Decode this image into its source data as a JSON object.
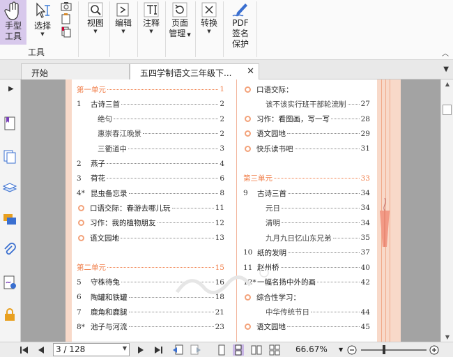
{
  "ribbon": {
    "hand_tool_line1": "手型",
    "hand_tool_line2": "工具",
    "select": "选择",
    "view": "视图",
    "edit": "编辑",
    "annotate": "注释",
    "page_manage_line1": "页面",
    "page_manage_line2": "管理",
    "convert": "转换",
    "pdf_protect_line1": "PDF",
    "pdf_protect_line2": "签名",
    "pdf_protect_line3": "保护",
    "tools_group": "工具"
  },
  "tabs": [
    {
      "label": "开始"
    },
    {
      "label": "五四学制语文三年级下..."
    }
  ],
  "toc_left": [
    {
      "num": "",
      "title": "第一单元",
      "page": "1",
      "kind": "unit"
    },
    {
      "num": "1",
      "title": "古诗三首",
      "page": "2",
      "kind": "item"
    },
    {
      "num": "",
      "title": "绝句",
      "page": "2",
      "kind": "sub"
    },
    {
      "num": "",
      "title": "惠崇春江晚景",
      "page": "2",
      "kind": "sub"
    },
    {
      "num": "",
      "title": "三衢道中",
      "page": "3",
      "kind": "sub"
    },
    {
      "num": "2",
      "title": "燕子",
      "page": "4",
      "kind": "item"
    },
    {
      "num": "3",
      "title": "荷花",
      "page": "6",
      "kind": "item"
    },
    {
      "num": "4*",
      "title": "昆虫备忘录",
      "page": "8",
      "kind": "item"
    },
    {
      "num": "",
      "title": "口语交际：春游去哪儿玩",
      "page": "11",
      "kind": "bullet"
    },
    {
      "num": "",
      "title": "习作：我的植物朋友",
      "page": "12",
      "kind": "bullet"
    },
    {
      "num": "",
      "title": "语文园地",
      "page": "13",
      "kind": "bullet"
    },
    {
      "num": "",
      "title": "",
      "page": "",
      "kind": "blank"
    },
    {
      "num": "",
      "title": "第二单元",
      "page": "15",
      "kind": "unit"
    },
    {
      "num": "5",
      "title": "守株待兔",
      "page": "16",
      "kind": "item"
    },
    {
      "num": "6",
      "title": "陶罐和铁罐",
      "page": "18",
      "kind": "item"
    },
    {
      "num": "7",
      "title": "鹿角和鹿腿",
      "page": "21",
      "kind": "item"
    },
    {
      "num": "8*",
      "title": "池子与河流",
      "page": "23",
      "kind": "item"
    }
  ],
  "toc_right": [
    {
      "num": "",
      "title": "口语交际：",
      "page": "",
      "kind": "bullet"
    },
    {
      "num": "",
      "title": "该不该实行班干部轮流制",
      "page": "27",
      "kind": "sub"
    },
    {
      "num": "",
      "title": "习作：看图画，写一写",
      "page": "28",
      "kind": "bullet"
    },
    {
      "num": "",
      "title": "语文园地",
      "page": "29",
      "kind": "bullet"
    },
    {
      "num": "",
      "title": "快乐读书吧",
      "page": "31",
      "kind": "bullet"
    },
    {
      "num": "",
      "title": "",
      "page": "",
      "kind": "blank"
    },
    {
      "num": "",
      "title": "第三单元",
      "page": "33",
      "kind": "unit"
    },
    {
      "num": "9",
      "title": "古诗三首",
      "page": "34",
      "kind": "item"
    },
    {
      "num": "",
      "title": "元日",
      "page": "34",
      "kind": "sub"
    },
    {
      "num": "",
      "title": "清明",
      "page": "34",
      "kind": "sub"
    },
    {
      "num": "",
      "title": "九月九日忆山东兄弟",
      "page": "35",
      "kind": "sub"
    },
    {
      "num": "10",
      "title": "纸的发明",
      "page": "37",
      "kind": "item"
    },
    {
      "num": "11",
      "title": "赵州桥",
      "page": "40",
      "kind": "item"
    },
    {
      "num": "12*",
      "title": "一幅名扬中外的画",
      "page": "42",
      "kind": "item"
    },
    {
      "num": "",
      "title": "综合性学习：",
      "page": "",
      "kind": "bullet"
    },
    {
      "num": "",
      "title": "中华传统节日",
      "page": "44",
      "kind": "sub"
    },
    {
      "num": "",
      "title": "语文园地",
      "page": "45",
      "kind": "bullet"
    }
  ],
  "status": {
    "page_value": "3 / 128",
    "zoom": "66.67%",
    "zoom_level_fraction": 0.35
  },
  "colors": {
    "accent_purple": "#c9b6e6",
    "toc_orange": "#f07b45",
    "stripe_peach": "#f8d9c9"
  }
}
